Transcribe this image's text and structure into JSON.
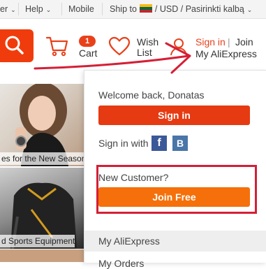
{
  "topbar": {
    "first_label": "er",
    "help_label": "Help",
    "mobile_label": "Mobile",
    "ship_to_label": "Ship to",
    "currency": "USD",
    "language": "Pasirinkti kalbą"
  },
  "header": {
    "cart_count": "1",
    "cart_label": "Cart",
    "wish_label": "Wish List",
    "signin_label": "Sign in",
    "separator": "|",
    "join_label": "Join",
    "my_aliexpress_label": "My AliExpress"
  },
  "banners": {
    "caption1": "es for the New Season",
    "caption2": "d Sports Equipment"
  },
  "dropdown": {
    "welcome": "Welcome back, Donatas",
    "signin_button": "Sign in",
    "signin_with": "Sign in with",
    "facebook_letter": "f",
    "vk_letter": "B",
    "new_customer": "New Customer?",
    "join_button": "Join Free",
    "menu_item1": "My AliExpress",
    "menu_item2": "My Orders"
  },
  "colors": {
    "accent": "#e63a12",
    "join_orange": "#f5700a",
    "annotation_red": "#d51f36",
    "facebook": "#3b5998"
  }
}
